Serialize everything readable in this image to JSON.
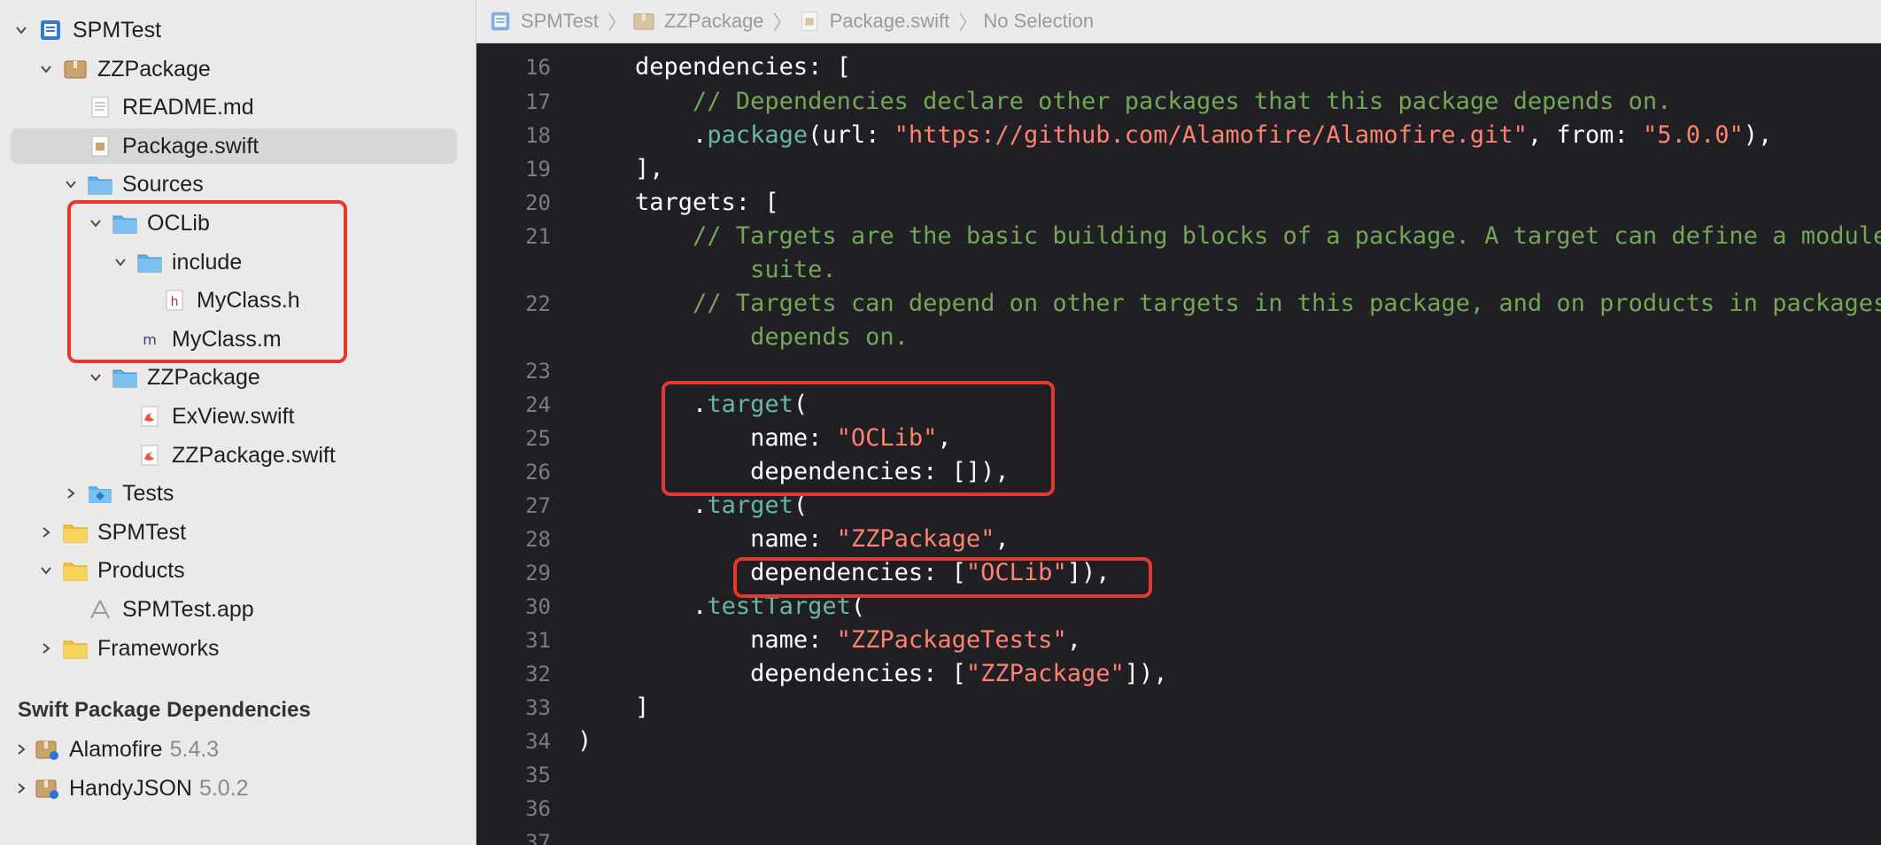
{
  "sidebar": {
    "items": [
      {
        "label": "SPMTest",
        "icon": "xcode-project-icon",
        "chevron": "down"
      },
      {
        "label": "ZZPackage",
        "icon": "package-icon",
        "chevron": "down"
      },
      {
        "label": "README.md",
        "icon": "text-file-icon",
        "chevron": ""
      },
      {
        "label": "Package.swift",
        "icon": "package-manifest-icon",
        "chevron": "",
        "selected": true
      },
      {
        "label": "Sources",
        "icon": "sources-folder-icon",
        "chevron": "down"
      },
      {
        "label": "OCLib",
        "icon": "blue-folder-icon",
        "chevron": "down"
      },
      {
        "label": "include",
        "icon": "blue-folder-icon",
        "chevron": "down"
      },
      {
        "label": "MyClass.h",
        "icon": "header-file-icon",
        "chevron": ""
      },
      {
        "label": "MyClass.m",
        "icon": "objc-file-icon",
        "chevron": ""
      },
      {
        "label": "ZZPackage",
        "icon": "blue-folder-icon",
        "chevron": "down"
      },
      {
        "label": "ExView.swift",
        "icon": "swift-file-icon",
        "chevron": ""
      },
      {
        "label": "ZZPackage.swift",
        "icon": "swift-file-icon",
        "chevron": ""
      },
      {
        "label": "Tests",
        "icon": "tests-folder-icon",
        "chevron": "right"
      },
      {
        "label": "SPMTest",
        "icon": "yellow-folder-icon",
        "chevron": "right"
      },
      {
        "label": "Products",
        "icon": "yellow-folder-icon",
        "chevron": "down"
      },
      {
        "label": "SPMTest.app",
        "icon": "app-icon",
        "chevron": ""
      },
      {
        "label": "Frameworks",
        "icon": "yellow-folder-icon",
        "chevron": "right"
      }
    ],
    "dependencies_header": "Swift Package Dependencies",
    "dependencies": [
      {
        "label": "Alamofire",
        "version": "5.4.3",
        "icon": "package-dependency-icon"
      },
      {
        "label": "HandyJSON",
        "version": "5.0.2",
        "icon": "package-dependency-icon"
      }
    ]
  },
  "jumpbar": {
    "crumbs": [
      {
        "label": "SPMTest",
        "icon": "xcode-project-icon"
      },
      {
        "label": "ZZPackage",
        "icon": "package-icon"
      },
      {
        "label": "Package.swift",
        "icon": "package-manifest-icon"
      },
      {
        "label": "No Selection",
        "icon": ""
      }
    ]
  },
  "editor": {
    "lines": [
      {
        "n": "16",
        "parts": [
          [
            "    dependencies: [",
            ""
          ]
        ]
      },
      {
        "n": "17",
        "parts": [
          [
            "        // Dependencies declare other packages that this package depends on.",
            "cm"
          ]
        ]
      },
      {
        "n": "18",
        "parts": [
          [
            "        .",
            ""
          ],
          [
            "package",
            "fn"
          ],
          [
            "(url: ",
            ""
          ],
          [
            "\"https://github.com/Alamofire/Alamofire.git\"",
            "st"
          ],
          [
            ", from: ",
            ""
          ],
          [
            "\"5.0.0\"",
            "st"
          ],
          [
            "),",
            ""
          ]
        ]
      },
      {
        "n": "19",
        "parts": [
          [
            "    ],",
            ""
          ]
        ]
      },
      {
        "n": "20",
        "parts": [
          [
            "    targets: [",
            ""
          ]
        ]
      },
      {
        "n": "21",
        "parts": [
          [
            "        // Targets are the basic building blocks of a package. A target can define a module or a test",
            "cm"
          ]
        ]
      },
      {
        "n": "",
        "parts": [
          [
            "            suite.",
            "cm"
          ]
        ]
      },
      {
        "n": "22",
        "parts": [
          [
            "        // Targets can depend on other targets in this package, and on products in packages this package",
            "cm"
          ]
        ]
      },
      {
        "n": "",
        "parts": [
          [
            "            depends on.",
            "cm"
          ]
        ]
      },
      {
        "n": "23",
        "parts": [
          [
            "",
            ""
          ]
        ]
      },
      {
        "n": "24",
        "parts": [
          [
            "        .",
            ""
          ],
          [
            "target",
            "fn"
          ],
          [
            "(",
            ""
          ]
        ]
      },
      {
        "n": "25",
        "parts": [
          [
            "            name: ",
            ""
          ],
          [
            "\"OCLib\"",
            "st"
          ],
          [
            ",",
            ""
          ]
        ]
      },
      {
        "n": "26",
        "parts": [
          [
            "            dependencies: []),",
            ""
          ]
        ]
      },
      {
        "n": "27",
        "parts": [
          [
            "        .",
            ""
          ],
          [
            "target",
            "fn"
          ],
          [
            "(",
            ""
          ]
        ]
      },
      {
        "n": "28",
        "parts": [
          [
            "            name: ",
            ""
          ],
          [
            "\"ZZPackage\"",
            "st"
          ],
          [
            ",",
            ""
          ]
        ]
      },
      {
        "n": "29",
        "parts": [
          [
            "            dependencies: [",
            ""
          ],
          [
            "\"OCLib\"",
            "st"
          ],
          [
            "]),",
            ""
          ]
        ]
      },
      {
        "n": "30",
        "parts": [
          [
            "        .",
            ""
          ],
          [
            "testTarget",
            "fn"
          ],
          [
            "(",
            ""
          ]
        ]
      },
      {
        "n": "31",
        "parts": [
          [
            "            name: ",
            ""
          ],
          [
            "\"ZZPackageTests\"",
            "st"
          ],
          [
            ",",
            ""
          ]
        ]
      },
      {
        "n": "32",
        "parts": [
          [
            "            dependencies: [",
            ""
          ],
          [
            "\"ZZPackage\"",
            "st"
          ],
          [
            "]),",
            ""
          ]
        ]
      },
      {
        "n": "33",
        "parts": [
          [
            "    ]",
            ""
          ]
        ]
      },
      {
        "n": "34",
        "parts": [
          [
            ")",
            ""
          ]
        ]
      },
      {
        "n": "35",
        "parts": [
          [
            "",
            ""
          ]
        ]
      },
      {
        "n": "36",
        "parts": [
          [
            "",
            ""
          ]
        ]
      },
      {
        "n": "37",
        "parts": [
          [
            "",
            ""
          ]
        ]
      }
    ]
  },
  "colors": {
    "comment": "#73a656",
    "string": "#ff8170",
    "function": "#67b7a4",
    "highlight_box": "#e6392d",
    "editor_bg": "#1f1f24"
  }
}
